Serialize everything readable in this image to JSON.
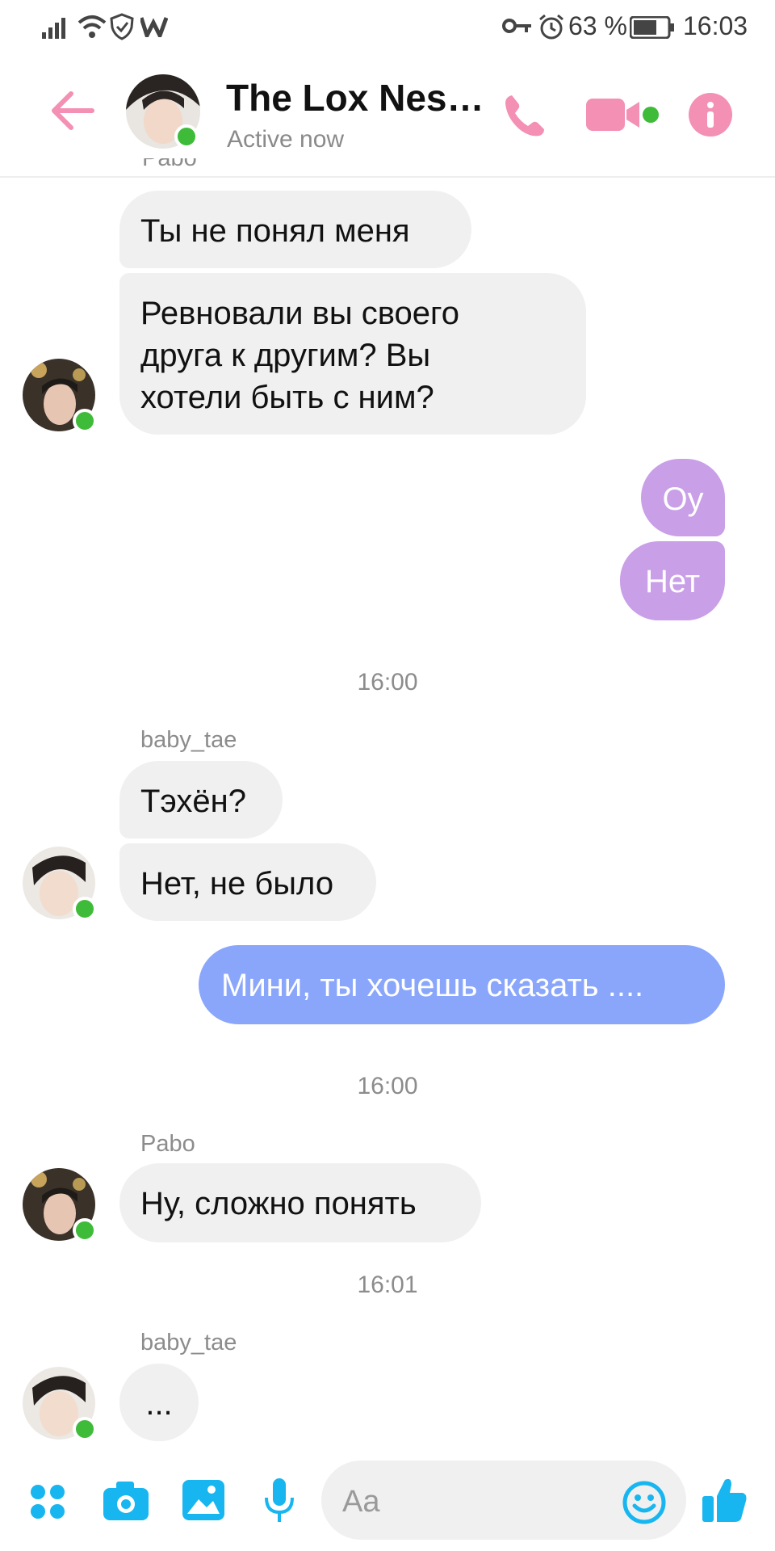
{
  "status_bar": {
    "battery": "63 %",
    "time": "16:03"
  },
  "header": {
    "title": "The Lox Nes…",
    "status": "Active now",
    "icons": [
      "back-arrow-icon",
      "phone-icon",
      "video-camera-icon",
      "info-icon"
    ],
    "accent_color": "#f390b4"
  },
  "messages": {
    "cut_sender": "Pabo",
    "m1": "Ты не понял меня",
    "m2_line1": "Ревновали вы своего",
    "m2_line2": "друга к другим? Вы",
    "m2_line3": "хотели быть с ним?",
    "m3": "Оу",
    "m4": "Нет",
    "time1": "16:00",
    "sender_baby_tae": "baby_tae",
    "m5": "Тэхён?",
    "m6": "Нет, не было",
    "m7": "Мини, ты хочешь сказать ....",
    "time2": "16:00",
    "sender_pabo": "Pabo",
    "m8": "Ну, сложно понять",
    "time3": "16:01",
    "sender_baby_tae_2": "baby_tae",
    "m9": "..."
  },
  "composer": {
    "placeholder": "Aa",
    "icons": [
      "apps-icon",
      "camera-icon",
      "gallery-icon",
      "microphone-icon",
      "emoji-icon",
      "thumbs-up-icon"
    ],
    "icon_color": "#17b6f0"
  },
  "colors": {
    "bubble_purple": "#c99fe8",
    "bubble_blue": "#8aa6fb",
    "bubble_incoming": "#f0f0f0",
    "online_dot": "#3fbb3a"
  }
}
